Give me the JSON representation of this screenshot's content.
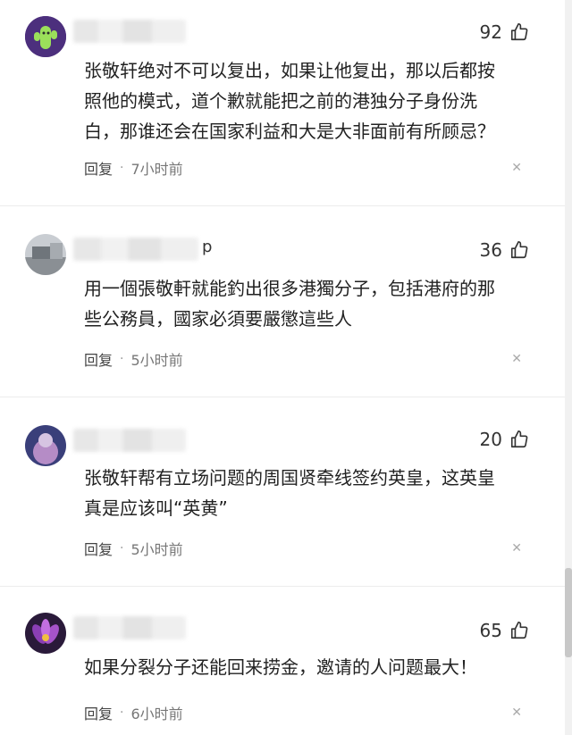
{
  "comments": [
    {
      "likes": "92",
      "text_lines": [
        "张敬轩绝对不可以复出，如果让他复出，那以后都按",
        "照他的模式，道个歉就能把之前的港独分子身份洗",
        "白，那谁还会在国家利益和大是大非面前有所顾忌？"
      ],
      "reply": "回复",
      "time": "7小时前"
    },
    {
      "likes": "36",
      "username_tail": "p",
      "text_lines": [
        "用一個張敬軒就能釣出很多港獨分子，包括港府的那",
        "些公務員，國家必須要嚴懲這些人"
      ],
      "reply": "回复",
      "time": "5小时前"
    },
    {
      "likes": "20",
      "text_lines": [
        "张敬轩帮有立场问题的周国贤牵线签约英皇，这英皇",
        "真是应该叫“英黄”"
      ],
      "reply": "回复",
      "time": "5小时前"
    },
    {
      "likes": "65",
      "text_lines": [
        "如果分裂分子还能回来捞金，邀请的人问题最大！"
      ],
      "reply": "回复",
      "time": "6小时前"
    }
  ],
  "icons": {
    "like": "thumbs-up-icon",
    "close": "close-icon"
  },
  "colors": {
    "text": "#222222",
    "meta": "#777777",
    "background": "#ffffff"
  }
}
